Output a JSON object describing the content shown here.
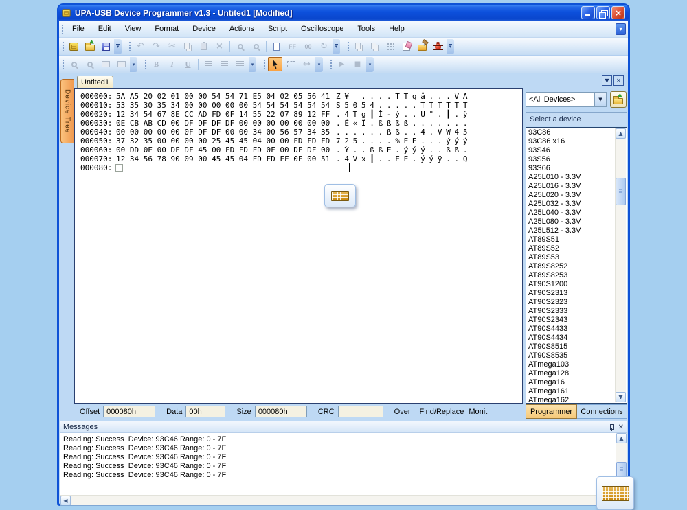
{
  "colors": {
    "titlebar_blue": "#0E52D6",
    "active_orange": "#F9A243",
    "desktop_blue": "#A5CFF0"
  },
  "window": {
    "title": "UPA-USB Device Programmer v1.3 - Untited1 [Modified]"
  },
  "menu": {
    "items": [
      "File",
      "Edit",
      "View",
      "Format",
      "Device",
      "Actions",
      "Script",
      "Oscilloscope",
      "Tools",
      "Help"
    ]
  },
  "icons": {
    "undo": "↶",
    "redo": "↷",
    "cut": "✂",
    "delete": "×",
    "refresh": "↻",
    "width_arrow": "↔",
    "play": "▶",
    "stop": "■",
    "chevron_down": "▾",
    "combo_arrow": "▼",
    "overflow": "▾",
    "scroll_up": "▲",
    "scroll_down": "▼",
    "scroll_left": "◀",
    "dock_collapse": "▼",
    "dock_close": "✕",
    "panel_close": "✕",
    "window_close": "×"
  },
  "toolbar_labels": {
    "ff": "FF",
    "zeros": "00",
    "bold": "B",
    "italic": "I",
    "underline": "U"
  },
  "document": {
    "tab_label": "Untited1",
    "side_tab_label": "Device Tree"
  },
  "hex_editor": {
    "rows": [
      {
        "offset": "000000:",
        "bytes": "5A A5 20 02 01 00 00 54 54 71 E5 04 02 05 56 41",
        "ascii": "Z¥ ....TTqå...VA"
      },
      {
        "offset": "000010:",
        "bytes": "53 35 30 35 34 00 00 00 00 00 54 54 54 54 54 54",
        "ascii": "S5054.....TTTTTT"
      },
      {
        "offset": "000020:",
        "bytes": "12 34 54 67 8E CC AD FD 0F 14 55 22 07 89 12 FF",
        "ascii": ".4Tg┃Ì-ý..U\".┃.ÿ"
      },
      {
        "offset": "000030:",
        "bytes": "0E CB AB CD 00 DF DF DF DF 00 00 00 00 00 00 00",
        "ascii": ".Ë«Ï.ßßßß......."
      },
      {
        "offset": "000040:",
        "bytes": "00 00 00 00 00 0F DF DF 00 00 34 00 56 57 34 35",
        "ascii": "......ßß..4.VW45"
      },
      {
        "offset": "000050:",
        "bytes": "37 32 35 00 00 00 00 25 45 45 04 00 00 FD FD FD",
        "ascii": "725....%EE...ýýý"
      },
      {
        "offset": "000060:",
        "bytes": "00 DD 0E 00 DF DF 45 00 FD FD FD 0F 00 DF DF 00",
        "ascii": ".Ý..ßßE.ýýý..ßß."
      },
      {
        "offset": "000070:",
        "bytes": "12 34 56 78 90 09 00 45 45 04 FD FD FF 0F 00 51",
        "ascii": ".4Vx┃..EE.ýýÿ..Q"
      }
    ],
    "last_offset": "000080:"
  },
  "device_panel": {
    "filter_value": "<All Devices>",
    "list_header": "Select a device",
    "devices": [
      "93C86",
      "93C86 x16",
      "93S46",
      "93S56",
      "93S66",
      "A25L010 - 3.3V",
      "A25L016 - 3.3V",
      "A25L020 - 3.3V",
      "A25L032 - 3.3V",
      "A25L040 - 3.3V",
      "A25L080 - 3.3V",
      "A25L512 - 3.3V",
      "AT89S51",
      "AT89S52",
      "AT89S53",
      "AT89S8252",
      "AT89S8253",
      "AT90S1200",
      "AT90S2313",
      "AT90S2323",
      "AT90S2333",
      "AT90S2343",
      "AT90S4433",
      "AT90S4434",
      "AT90S8515",
      "AT90S8535",
      "ATmega103",
      "ATmega128",
      "ATmega16",
      "ATmega161",
      "ATmega162"
    ]
  },
  "status_bar": {
    "offset_label": "Offset",
    "offset_value": "000080h",
    "data_label": "Data",
    "data_value": "00h",
    "size_label": "Size",
    "size_value": "000080h",
    "crc_label": "CRC",
    "crc_value": "",
    "over": "Over",
    "find_replace": "Find/Replace",
    "monit": "Monit"
  },
  "bottom_tabs": {
    "programmer": "Programmer",
    "connections": "Connections"
  },
  "messages": {
    "title": "Messages",
    "lines": [
      "Reading: Success  Device: 93C46 Range: 0 - 7F",
      "Reading: Success  Device: 93C46 Range: 0 - 7F",
      "Reading: Success  Device: 93C46 Range: 0 - 7F",
      "Reading: Success  Device: 93C46 Range: 0 - 7F",
      "Reading: Success  Device: 93C46 Range: 0 - 7F"
    ]
  }
}
